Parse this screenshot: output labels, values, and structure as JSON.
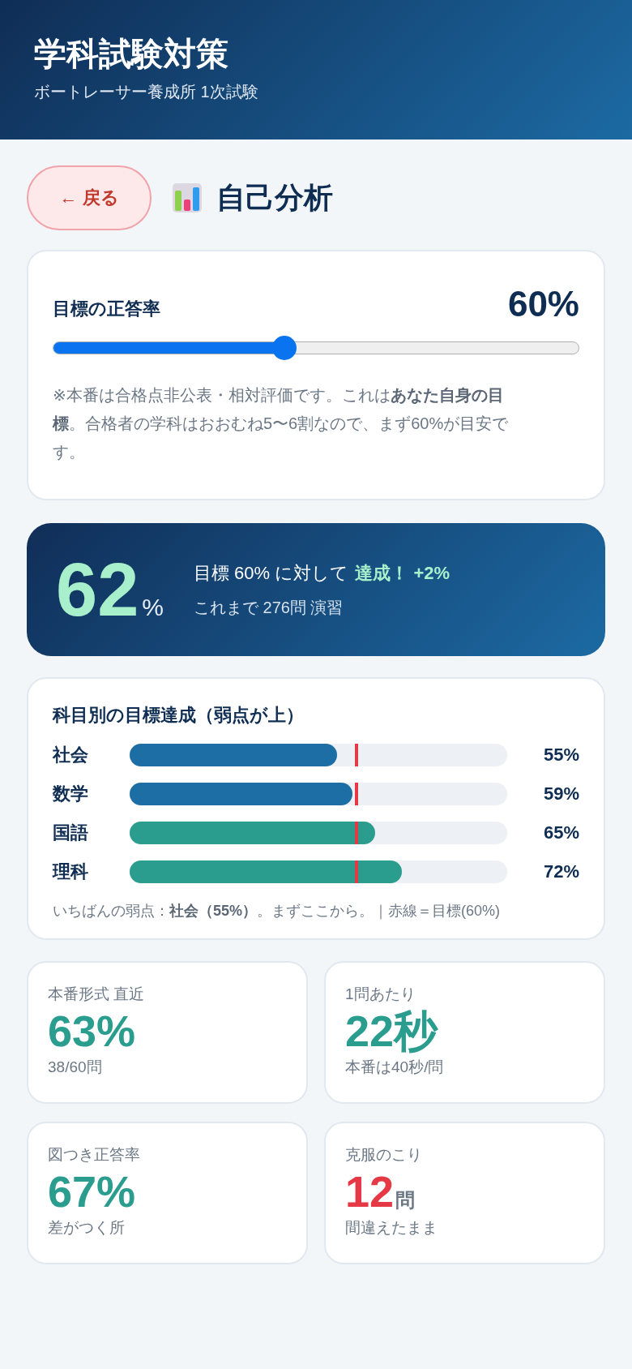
{
  "header": {
    "title": "学科試験対策",
    "subtitle": "ボートレーサー養成所 1次試験"
  },
  "back_button": {
    "label": "← 戻る"
  },
  "page_title": "自己分析",
  "target_card": {
    "label": "目標の正答率",
    "value": "60%",
    "slider": {
      "level": 0.44
    },
    "note": "※本番は合格点非公表・相対評価です。これは**あなた自身の目標**。合格者の学科はおおむね5〜6割なので、まず60%が目安です。"
  },
  "summary": {
    "value": "62",
    "unit": "%",
    "line1": "目標 60% に対して",
    "highlight": "達成！ +2%",
    "line2": "これまで 276問 演習"
  },
  "subjects": {
    "title": "科目別の目標達成（弱点が上）",
    "target_marker": {
      "level": 0.6
    },
    "items": [
      {
        "name": "社会",
        "level": 0.55,
        "reading": "55%",
        "color": "#1e6ea6"
      },
      {
        "name": "数学",
        "level": 0.59,
        "reading": "59%",
        "color": "#1e6ea6"
      },
      {
        "name": "国語",
        "level": 0.65,
        "reading": "65%",
        "color": "#2a9d8f"
      },
      {
        "name": "理科",
        "level": 0.72,
        "reading": "72%",
        "color": "#2a9d8f"
      }
    ],
    "footer": "いちばんの弱点：**社会（55%）**。まずここから。｜赤線＝目標(60%)"
  },
  "stats": [
    {
      "label": "本番形式 直近",
      "value": "63%",
      "sub": "38/60問",
      "color": "#2a9d8f"
    },
    {
      "label": "1問あたり",
      "value": "22秒",
      "sub": "本番は40秒/問",
      "color": "#2a9d8f"
    },
    {
      "label": "図つき正答率",
      "value": "67%",
      "sub": "差がつく所",
      "color": "#2a9d8f"
    },
    {
      "label": "克服のこり",
      "value": "12",
      "unit": "問",
      "sub": "間違えたまま",
      "color": "#e63946"
    }
  ]
}
